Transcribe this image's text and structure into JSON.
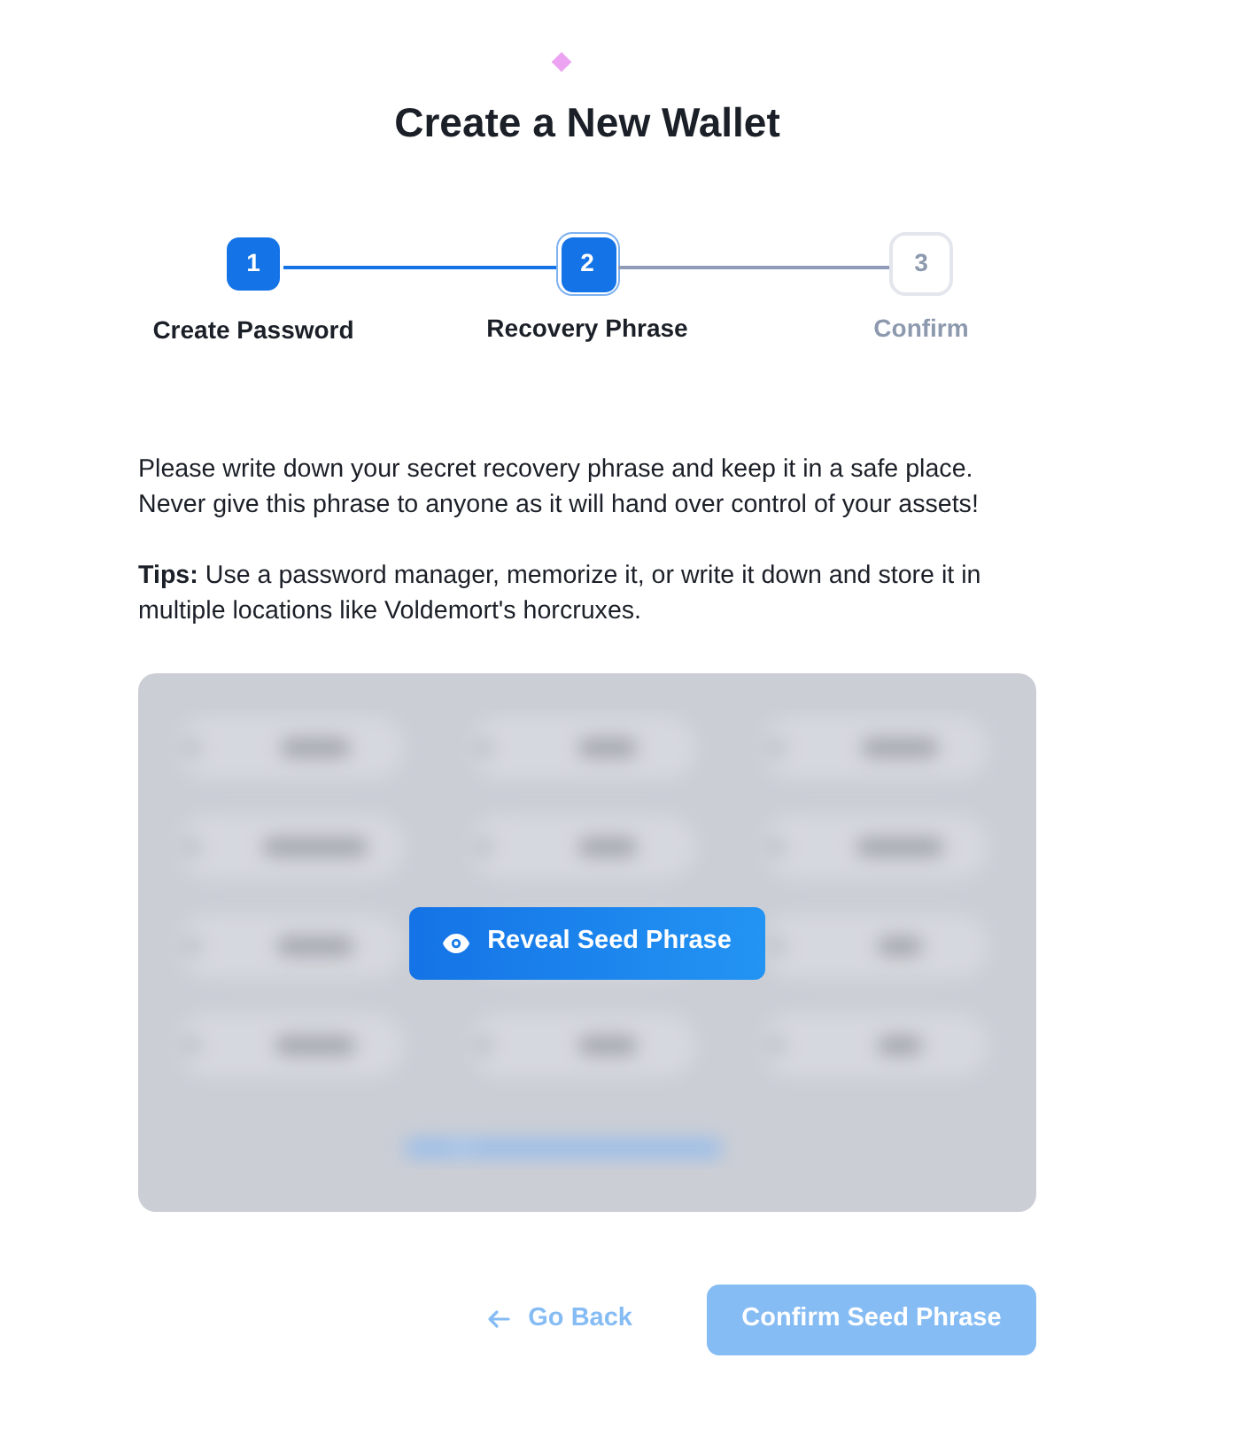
{
  "title": "Create a New Wallet",
  "steps": [
    {
      "number": "1",
      "label": "Create Password",
      "completed": true,
      "selected": false
    },
    {
      "number": "2",
      "label": "Recovery Phrase",
      "completed": false,
      "selected": true
    },
    {
      "number": "3",
      "label": "Confirm",
      "completed": false,
      "selected": false
    }
  ],
  "intro": "Please write down your secret recovery phrase and keep it in a safe place. Never give this phrase to anyone as it will hand over control of your assets!",
  "tips": "**Tips:** Use a password manager, memorize it, or write it down and store it in multiple locations like Voldemort's horcruxes.",
  "seed_panel": {
    "hidden": true,
    "reveal_button": "Reveal Seed Phrase"
  },
  "buttons": {
    "back": {
      "label": "Go Back",
      "disabled": true
    },
    "confirm": {
      "label": "Confirm Seed Phrase",
      "disabled": true
    }
  }
}
